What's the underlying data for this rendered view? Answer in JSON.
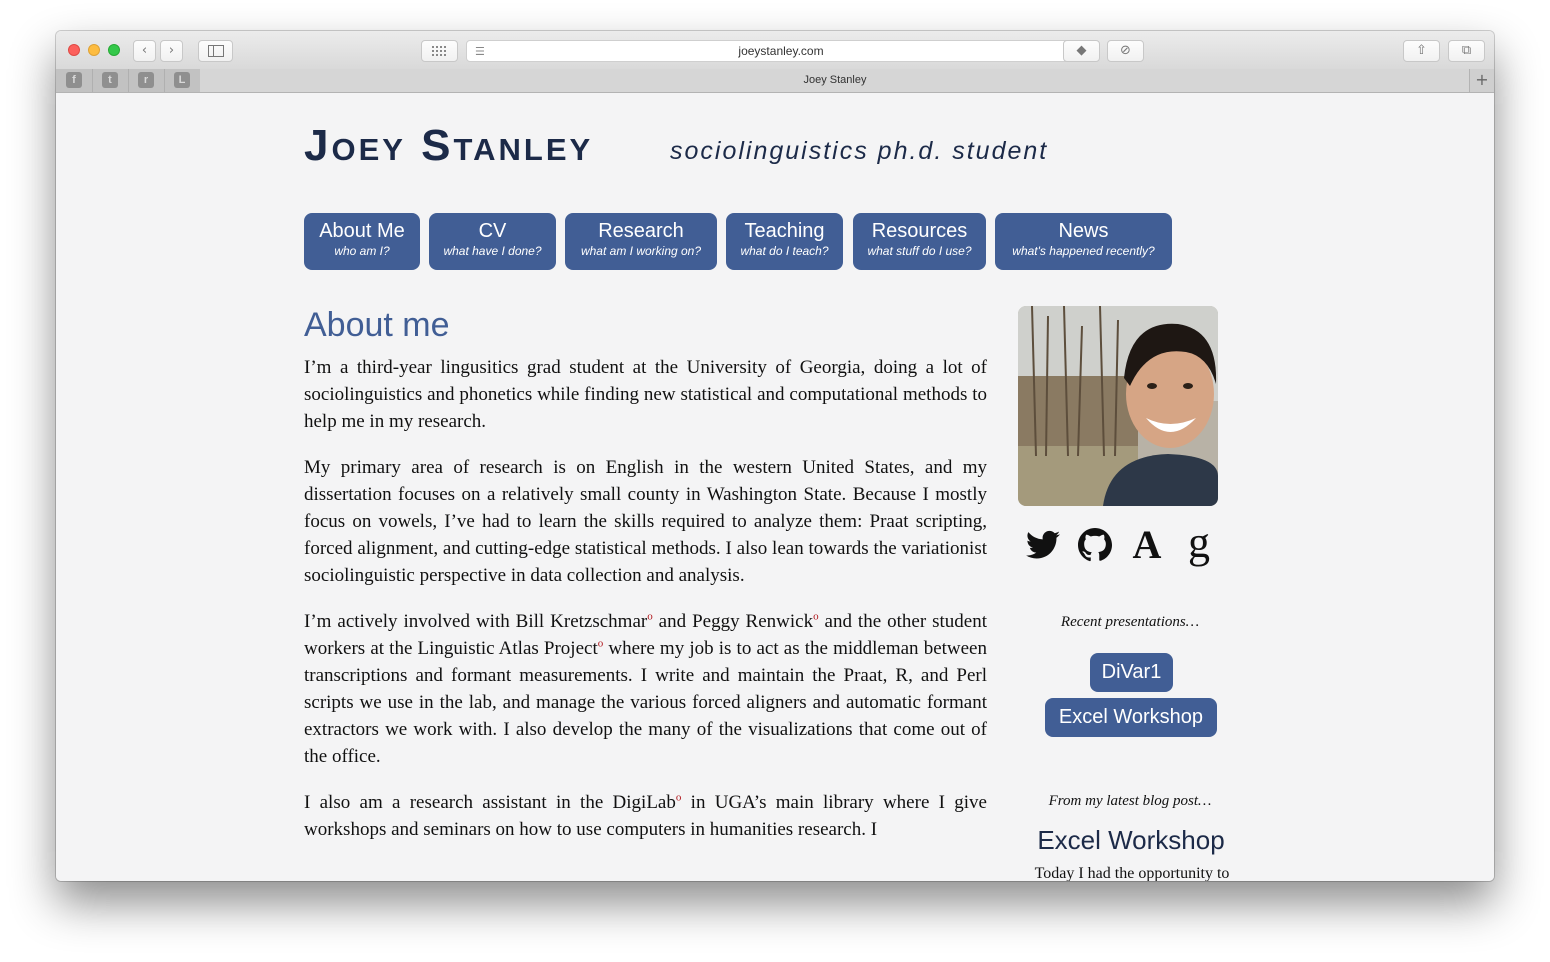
{
  "browser": {
    "url": "joeystanley.com",
    "tab_title": "Joey Stanley",
    "favorites": [
      {
        "icon": "facebook-icon",
        "glyph": "f"
      },
      {
        "icon": "twitter-icon",
        "glyph": "t"
      },
      {
        "icon": "reddit-icon",
        "glyph": "r"
      },
      {
        "icon": "l-bookmark-icon",
        "glyph": "L"
      }
    ]
  },
  "site": {
    "title": "Joey Stanley",
    "tagline": "sociolinguistics ph.d. student"
  },
  "nav": [
    {
      "label": "About Me",
      "sub": "who am I?"
    },
    {
      "label": "CV",
      "sub": "what have I done?"
    },
    {
      "label": "Research",
      "sub": "what am I working on?"
    },
    {
      "label": "Teaching",
      "sub": "what do I teach?"
    },
    {
      "label": "Resources",
      "sub": "what stuff do I use?"
    },
    {
      "label": "News",
      "sub": "what's happened recently?"
    }
  ],
  "about": {
    "heading": "About me",
    "p1": "I’m a third-year lingusitics grad student at the University of Georgia, doing a lot of sociolinguistics and phonetics while finding new statistical and computational methods to help me in my research.",
    "p2": "My primary area of research is on English in the western United States, and my dissertation focuses on a relatively small county in Washington State. Because I mostly focus on vowels, I’ve had to learn the skills required to analyze them: Praat scripting, forced alignment, and cutting-edge statistical methods. I also lean towards the variationist sociolinguistic perspective in data collection and analysis.",
    "p3_a": "I’m actively involved with Bill Kretzschmar",
    "p3_b": " and Peggy Renwick",
    "p3_c": " and the other student workers at the Linguistic Atlas Project",
    "p3_d": " where my job is to act as the middleman between transcriptions and formant measurements. I write and maintain the Praat, R, and Perl scripts we use in the lab, and manage the various forced aligners and automatic formant extractors we work with. I also develop the many of the visualizations that come out of the office.",
    "p4_a": "I also am a research assistant in the DigiLab",
    "p4_b": " in UGA’s main library where I give workshops and seminars on how to use computers in humanities research. I",
    "ext_mark": "o"
  },
  "sidebar": {
    "social": [
      "twitter-icon",
      "github-icon",
      "academia-icon",
      "google-scholar-icon"
    ],
    "social_glyphs": {
      "academia": "A",
      "scholar": "g"
    },
    "recent_label": "Recent presentations…",
    "presentations": [
      "DiVar1",
      "Excel Workshop"
    ],
    "blog_label": "From my latest blog post…",
    "blog_title": "Excel Workshop",
    "blog_excerpt": "Today I had the opportunity to"
  },
  "colors": {
    "accent": "#415e95",
    "title": "#1c2a48",
    "link_mark": "#b0151b"
  }
}
